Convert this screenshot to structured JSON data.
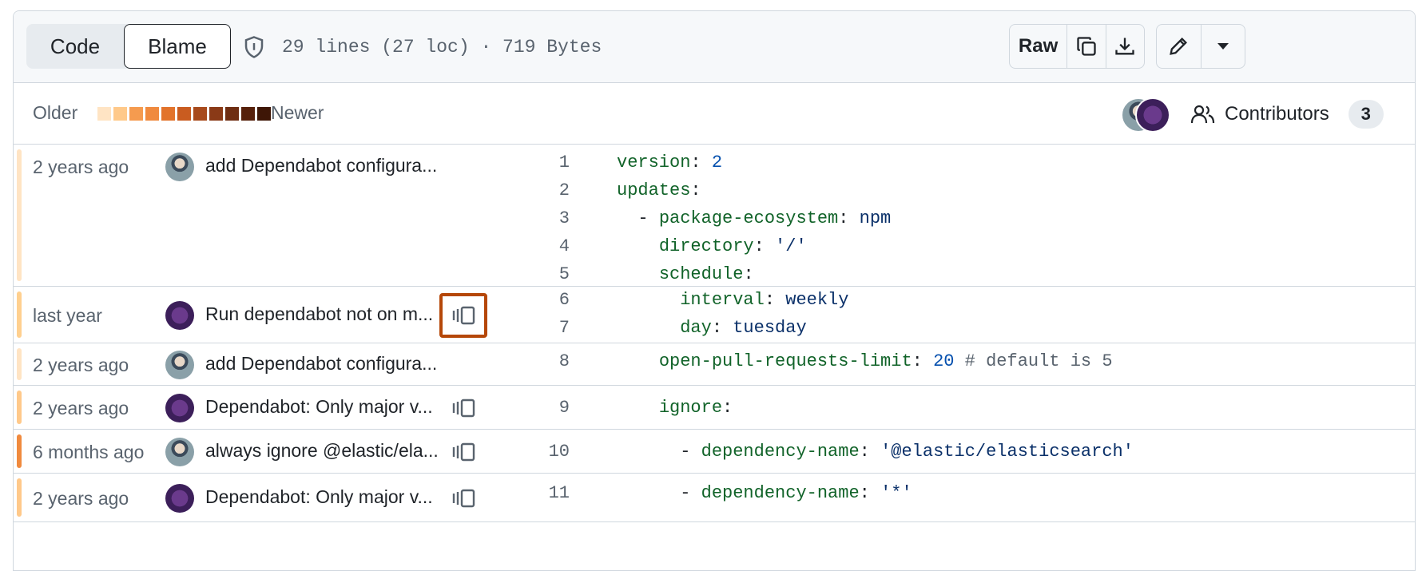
{
  "header": {
    "tab_code": "Code",
    "tab_blame": "Blame",
    "file_info": "29 lines (27 loc) · 719 Bytes",
    "raw_label": "Raw"
  },
  "legend": {
    "older": "Older",
    "newer": "Newer",
    "swatch_colors": [
      "#ffe4c4",
      "#ffc98a",
      "#f59b4f",
      "#f08a3e",
      "#e2732b",
      "#c95c20",
      "#a84a1c",
      "#8a3a17",
      "#6e2d12",
      "#56200b",
      "#3e1606"
    ]
  },
  "contributors": {
    "label": "Contributors",
    "count": "3"
  },
  "blame": [
    {
      "when": "2 years ago",
      "message": "add Dependabot configura...",
      "bar_color": "#ffe4c4",
      "avatar": "a",
      "reblame": false
    },
    {
      "when": "last year",
      "message": "Run dependabot not on m...",
      "bar_color": "#ffd08f",
      "avatar": "b",
      "reblame": true,
      "highlighted": true
    },
    {
      "when": "2 years ago",
      "message": "add Dependabot configura...",
      "bar_color": "#ffe4c4",
      "avatar": "a",
      "reblame": false
    },
    {
      "when": "2 years ago",
      "message": "Dependabot: Only major v...",
      "bar_color": "#ffc98a",
      "avatar": "b",
      "reblame": true
    },
    {
      "when": "6 months ago",
      "message": "always ignore @elastic/ela...",
      "bar_color": "#f08a3e",
      "avatar": "a",
      "reblame": true
    },
    {
      "when": "2 years ago",
      "message": "Dependabot: Only major v...",
      "bar_color": "#ffc98a",
      "avatar": "b",
      "reblame": true
    }
  ],
  "lines": [
    {
      "n": "1",
      "code": "version: 2"
    },
    {
      "n": "2",
      "code": "updates:"
    },
    {
      "n": "3",
      "code": "  - package-ecosystem: npm"
    },
    {
      "n": "4",
      "code": "    directory: '/'"
    },
    {
      "n": "5",
      "code": "    schedule:"
    },
    {
      "n": "6",
      "code": "      interval: weekly"
    },
    {
      "n": "7",
      "code": "      day: tuesday"
    },
    {
      "n": "8",
      "code": "    open-pull-requests-limit: 20 # default is 5"
    },
    {
      "n": "9",
      "code": "    ignore:"
    },
    {
      "n": "10",
      "code": "      - dependency-name: '@elastic/elasticsearch'"
    },
    {
      "n": "11",
      "code": "      - dependency-name: '*'"
    }
  ]
}
